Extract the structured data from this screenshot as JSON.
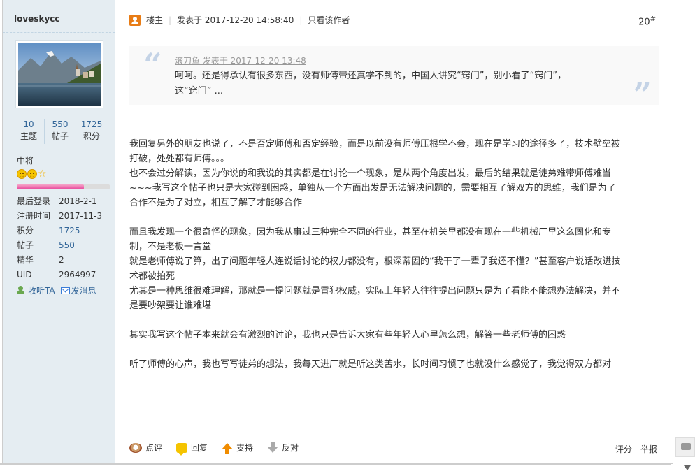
{
  "user": {
    "name": "loveskycc",
    "stats": [
      {
        "num": "10",
        "label": "主题"
      },
      {
        "num": "550",
        "label": "帖子"
      },
      {
        "num": "1725",
        "label": "积分"
      }
    ],
    "rank": "中将",
    "progress_fraction": 0.72,
    "info": [
      {
        "key": "最后登录",
        "value": "2018-2-1"
      },
      {
        "key": "注册时间",
        "value": "2017-11-3"
      },
      {
        "key": "积分",
        "value": "1725"
      },
      {
        "key": "帖子",
        "value": "550"
      },
      {
        "key": "精华",
        "value": "2"
      },
      {
        "key": "UID",
        "value": "2964997"
      }
    ],
    "actions": {
      "follow": "收听TA",
      "message": "发消息"
    }
  },
  "post": {
    "owner_label": "楼主",
    "posted_at": "发表于 2017-12-20 14:58:40",
    "author_only": "只看该作者",
    "floor": "20",
    "floor_mark": "#",
    "quote": {
      "title": "滚刀鱼 发表于 2017-12-20 13:48",
      "lines": [
        "呵呵。还是得承认有很多东西，没有师傅带还真学不到的，中国人讲究“窍门”，别小看了“窍门”，",
        "这“窍门” ..."
      ]
    },
    "paragraphs": [
      [
        "我回复另外的朋友也说了，不是否定师傅和否定经验，而是以前没有师傅压根学不会，现在是学习的途径多了，技术壁垒被",
        "打破，处处都有师傅。。。",
        "也不会过分解读，因为你说的和我说的其实都是在讨论一个现象，是从两个角度出发，最后的结果就是徒弟难带师傅难当",
        "~~~我写这个帖子也只是大家碰到困惑，单独从一个方面出发是无法解决问题的，需要相互了解双方的思维，我们是为了",
        "合作不是为了对立，相互了解了才能够合作"
      ],
      [
        "而且我发现一个很奇怪的现象，因为我从事过三种完全不同的行业，甚至在机关里都没有现在一些机械厂里这么固化和专",
        "制，不是老板一言堂",
        "就是老师傅说了算，出了问题年轻人连说话讨论的权力都没有，根深蒂固的“我干了一辈子我还不懂？”甚至客户说话改进技",
        "术都被拍死",
        "尤其是一种思维很难理解，那就是一提问题就是冒犯权威，实际上年轻人往往提出问题只是为了看能不能想办法解决，并不",
        "是要吵架要让谁难堪"
      ],
      [
        "其实我写这个帖子本来就会有激烈的讨论，我也只是告诉大家有些年轻人心里怎么想，解答一些老师傅的困惑"
      ],
      [
        "听了师傅的心声，我也写写徒弟的想法，我每天进厂就是听这类苦水，长时间习惯了也就没什么感觉了，我觉得双方都对"
      ]
    ],
    "footer": {
      "comment": "点评",
      "reply": "回复",
      "support": "支持",
      "oppose": "反对",
      "rate": "评分",
      "report": "举报"
    }
  }
}
